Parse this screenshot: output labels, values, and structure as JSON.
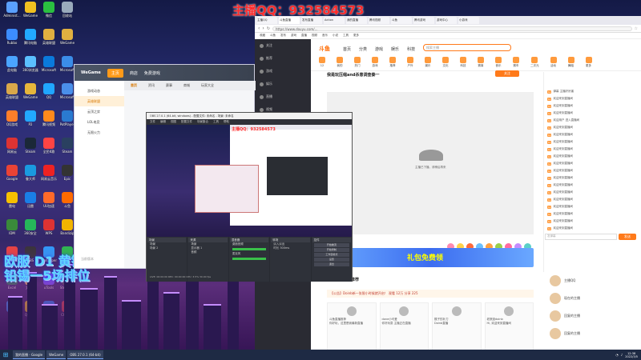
{
  "banner": "主播QQ：932584573",
  "overlay": {
    "line1": "欧服 D1 黄铜",
    "line2": "铅锡一5场排位"
  },
  "desktop_icons": [
    {
      "label": "Administ...",
      "color": "#5aa0ff"
    },
    {
      "label": "WeGame",
      "color": "#f0c020"
    },
    {
      "label": "微信",
      "color": "#2ac040"
    },
    {
      "label": "回收站",
      "color": "#9ab"
    },
    {
      "label": "Rubbo",
      "color": "#3c8cff"
    },
    {
      "label": "腾讯电脑",
      "color": "#22aaff"
    },
    {
      "label": "英雄联盟",
      "color": "#e0b040"
    },
    {
      "label": "WeGame",
      "color": "#e0b040"
    },
    {
      "label": "此电脑",
      "color": "#4aa4ff"
    },
    {
      "label": "360浏览器",
      "color": "#5ac0ff"
    },
    {
      "label": "Microsoft",
      "color": "#0a7adc"
    },
    {
      "label": "Microsoft",
      "color": "#3b8de8"
    },
    {
      "label": "英雄联盟",
      "color": "#d9a84a"
    },
    {
      "label": "WeGame",
      "color": "#e6b63b"
    },
    {
      "label": "QQ",
      "color": "#20a6ff"
    },
    {
      "label": "Microsoft",
      "color": "#4a8fea"
    },
    {
      "label": "QQ游戏",
      "color": "#ff7e2a"
    },
    {
      "label": "P2",
      "color": "#22a8ff"
    },
    {
      "label": "腾讯视频",
      "color": "#ff8a1c"
    },
    {
      "label": "PotPlayer",
      "color": "#2a7ad0"
    },
    {
      "label": "网易云",
      "color": "#d33"
    },
    {
      "label": "Steam",
      "color": "#1b2838"
    },
    {
      "label": "全民K歌",
      "color": "#f44"
    },
    {
      "label": "Steam",
      "color": "#2a4060"
    },
    {
      "label": "Google",
      "color": "#ea4335"
    },
    {
      "label": "鲁大师",
      "color": "#1a9ae0"
    },
    {
      "label": "网易云音乐",
      "color": "#e22"
    },
    {
      "label": "Epic",
      "color": "#333"
    },
    {
      "label": "雷电",
      "color": "#f6c000"
    },
    {
      "label": "迅雷",
      "color": "#1a7ee6"
    },
    {
      "label": "UU加速",
      "color": "#ff6a2a"
    },
    {
      "label": "斗鱼",
      "color": "#ff6a00"
    },
    {
      "label": "IDM",
      "color": "#3a8a3a"
    },
    {
      "label": "360安全",
      "color": "#26b85a"
    },
    {
      "label": "WPS",
      "color": "#d33"
    },
    {
      "label": "Bandizip",
      "color": "#f2b400"
    },
    {
      "label": "AnyDesk",
      "color": "#ef443b"
    },
    {
      "label": "OBS",
      "color": "#333"
    },
    {
      "label": "Wallpaper",
      "color": "#2aa0ff"
    },
    {
      "label": "微信",
      "color": "#27c04a"
    },
    {
      "label": "Excel",
      "color": "#1d7a3d"
    },
    {
      "label": "文件夹",
      "color": "#f4c24a"
    },
    {
      "label": "uTools",
      "color": "#6a4bff"
    },
    {
      "label": "SteamVR",
      "color": "#444"
    },
    {
      "label": "Krita",
      "color": "#2aa0ff"
    },
    {
      "label": "QQ音乐",
      "color": "#ffd400"
    },
    {
      "label": "酷狗",
      "color": "#1a8cff"
    },
    {
      "label": "Chrome",
      "color": "#ea4335"
    }
  ],
  "browser": {
    "tabs": [
      "主播QQ",
      "斗鱼直播",
      "发布直播",
      "Action",
      "我的直播",
      "腾讯视频",
      "斗鱼",
      "腾讯游戏",
      "游戏中心",
      "小游戏"
    ],
    "url": "https://www.douyu.com/...",
    "bookmarks": [
      "收藏",
      "斗鱼",
      "发布",
      "游戏",
      "直播",
      "视频",
      "音乐",
      "小说",
      "工具",
      "更多"
    ]
  },
  "douyu": {
    "logo": "斗鱼",
    "nav": [
      "首页",
      "分类",
      "游戏",
      "娱乐",
      "科技"
    ],
    "search_placeholder": "搜索主播",
    "categories": [
      "12",
      "我的",
      "热门",
      "游戏",
      "推荐",
      "户外",
      "娱乐",
      "文化",
      "科技",
      "赛事",
      "音乐",
      "赛车",
      "二次元",
      "活动",
      "舞蹈",
      "更多"
    ],
    "side_items": [
      "关注",
      "推荐",
      "游戏",
      "娱乐",
      "直播",
      "视频",
      "鱼吧",
      "圈子",
      "排行",
      "商城",
      "签到",
      "发现",
      "消息",
      "设置"
    ],
    "stream_title": "我是玩压缩and杀意调查秦一",
    "player_tip": "主播已下播，请稍后再来",
    "gifts": [
      "棒棒糖",
      "鱼丸",
      "火箭",
      "飞机",
      "超火",
      "办卡",
      "告白",
      "贵族",
      "鲨鱼"
    ],
    "promo_text": "礼包免费领",
    "subscribe": "关注",
    "section_tabs": [
      "直播",
      "相关推荐"
    ],
    "notice": "【公告】Doinb新一张限小时候就开启！ 观看 12万  分享 225",
    "cards": [
      {
        "title": "斗鱼直播推荐",
        "sub": "你好玩，这里是我最新直播"
      },
      {
        "title": "done小可爱",
        "sub": "你好玩耍 主播正在直播"
      },
      {
        "title": "猴子的补刀",
        "sub": "Doinb直播"
      },
      {
        "title": "老狼逛doinb",
        "sub": "Hi, 欢迎来到直播间"
      }
    ]
  },
  "chat": {
    "lines": [
      "弹幕 主播好厉害",
      "欢迎来到直播间",
      "欢迎来到直播间",
      "欢迎来到直播间",
      "欢迎用户 进入直播间",
      "欢迎来到直播间",
      "欢迎来到直播间",
      "欢迎来到直播间",
      "欢迎来到直播间",
      "欢迎来到直播间",
      "欢迎来到直播间",
      "欢迎来到直播间",
      "欢迎来到直播间",
      "欢迎来到直播间",
      "欢迎来到直播间",
      "欢迎来到直播间",
      "欢迎来到直播间",
      "欢迎来到直播间",
      "欢迎来到直播间",
      "欢迎来到直播间"
    ],
    "input_placeholder": "发弹幕",
    "send": "发送",
    "fans": [
      "主播QQ",
      "现在的主播",
      "回复的主播",
      "回复的主播"
    ]
  },
  "wegame": {
    "logo": "WeGame",
    "tabs": [
      "主页",
      "商店",
      "免费游戏"
    ],
    "side": [
      "游戏动态",
      "英雄联盟",
      "云顶之弈",
      "LOL电竞",
      "无限火力"
    ],
    "sub_tabs": [
      "首页",
      "资讯",
      "赛事",
      "商城",
      "玩家大全"
    ],
    "footer": "当前版本"
  },
  "obs": {
    "title": "OBS 27.0.1 (64-bit, windows) - 配置文件: 未命名 - 场景: 未命名",
    "menu": [
      "文件",
      "编辑",
      "视图",
      "配置文件",
      "场景集合",
      "工具",
      "帮助"
    ],
    "preview_qq": "主播QQ：932584573",
    "docks": [
      {
        "title": "场景",
        "items": [
          "场景",
          "场景 2"
        ]
      },
      {
        "title": "来源",
        "items": [
          "场景",
          "显示器 1",
          "音频"
        ]
      },
      {
        "title": "混音器",
        "items": [
          "桌面音频",
          "麦克风"
        ]
      },
      {
        "title": "转场",
        "items": [
          "淡入淡出",
          "时长 300ms"
        ]
      },
      {
        "title": "控件",
        "items": [
          "开始推流",
          "开始录制",
          "工作室模式",
          "设置",
          "退出"
        ]
      }
    ],
    "status": "LIVE: 00:00:00  REC: 00:00:00  CPU: 3.5%  30.00 fps"
  },
  "taskbar": {
    "tasks": [
      "我的直播 - Google",
      "WeGame",
      "OBS 27.0.1 (64-bit)"
    ],
    "time": "12:38",
    "date": "2022/3/5"
  }
}
